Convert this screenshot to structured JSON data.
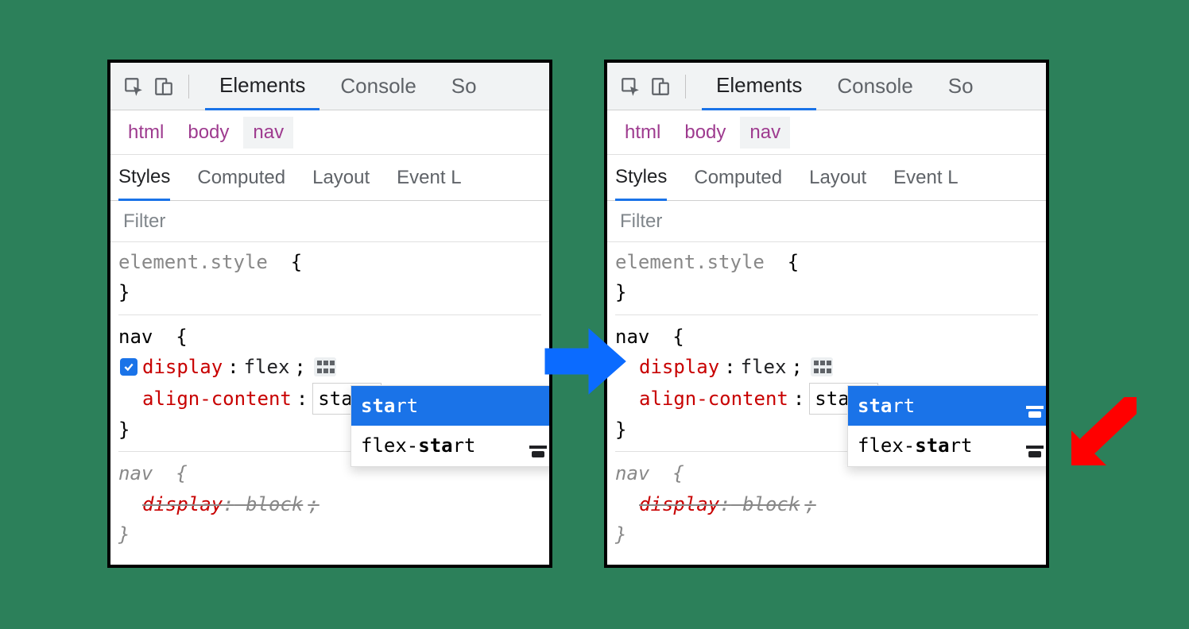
{
  "toolbar": {
    "tabs": [
      "Elements",
      "Console",
      "So"
    ],
    "active": 0
  },
  "breadcrumb": [
    "html",
    "body",
    "nav"
  ],
  "subtabs": [
    "Styles",
    "Computed",
    "Layout",
    "Event L"
  ],
  "filter_placeholder": "Filter",
  "rules": {
    "element_style": {
      "selector": "element.style",
      "open": "{",
      "close": "}"
    },
    "nav_rule": {
      "selector": "nav",
      "open": "{",
      "close": "}",
      "props": [
        {
          "name": "display",
          "value": "flex",
          "has_flex_icon": true,
          "has_checkbox_left": true
        },
        {
          "name": "align-content",
          "value": "start",
          "editing": true
        }
      ]
    },
    "nav_inherited": {
      "selector": "nav",
      "open": "{",
      "close": "}",
      "props": [
        {
          "name": "display",
          "value": "block",
          "overridden": true
        }
      ]
    }
  },
  "autocomplete": {
    "options": [
      {
        "label_pre": "sta",
        "label_post": "rt",
        "icon": null,
        "selected": true
      },
      {
        "label_pre": "flex-",
        "label_mid": "sta",
        "label_post": "rt",
        "icon": "align-start"
      }
    ]
  },
  "autocomplete_right": {
    "options": [
      {
        "label_pre": "sta",
        "label_post": "rt",
        "icon": "align-start-light",
        "selected": true
      },
      {
        "label_pre": "flex-",
        "label_mid": "sta",
        "label_post": "rt",
        "icon": "align-start-dark"
      }
    ]
  },
  "punct": {
    "semicolon": ";",
    "openbrace": "{",
    "closebrace": "}"
  }
}
